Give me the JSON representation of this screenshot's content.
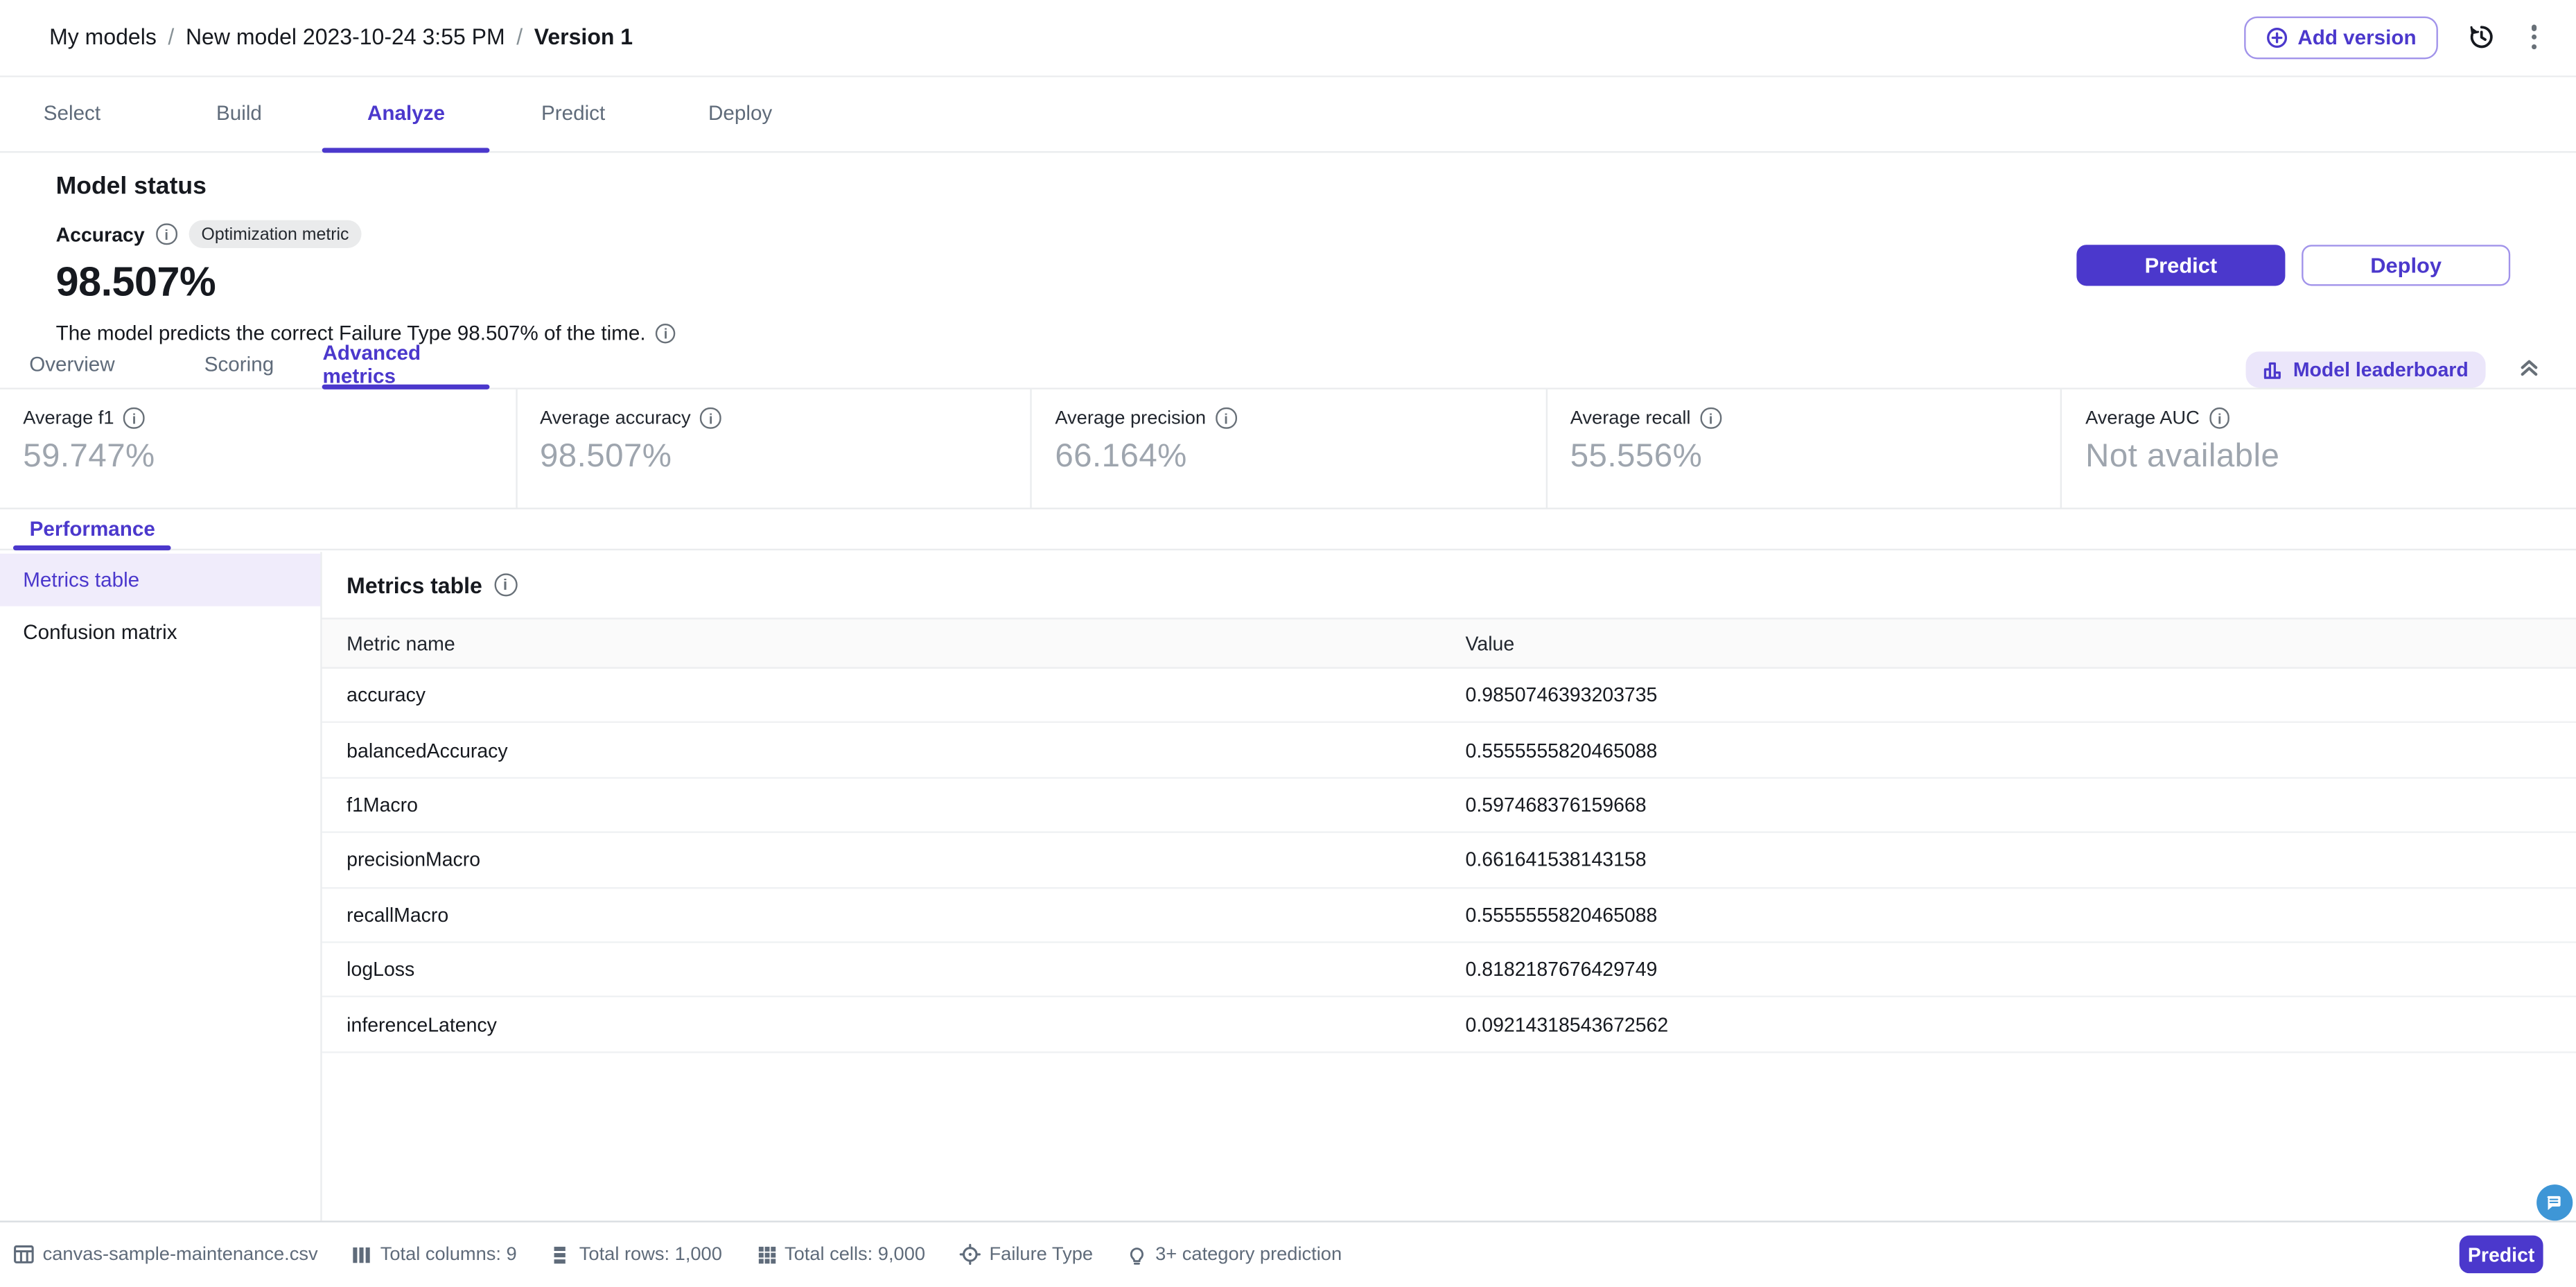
{
  "colors": {
    "accent": "#4B38CC",
    "accent_light_bg": "#F0ECFB",
    "leaderboard_bg": "#EBE6FA",
    "chat_fab": "#3E96D6"
  },
  "header": {
    "breadcrumb": [
      "My models",
      "New model 2023-10-24 3:55 PM",
      "Version 1"
    ],
    "breadcrumb_separator": "/",
    "add_version_label": "Add version",
    "icons": {
      "add_version": "plus-circle-icon",
      "history": "history-icon",
      "more": "kebab-menu-icon"
    }
  },
  "primary_tabs": {
    "items": [
      "Select",
      "Build",
      "Analyze",
      "Predict",
      "Deploy"
    ],
    "active": "Analyze"
  },
  "model_status": {
    "title": "Model status",
    "metric_label": "Accuracy",
    "optimization_badge": "Optimization metric",
    "value": "98.507%",
    "description": "The model predicts the correct Failure Type 98.507% of the time.",
    "predict_button": "Predict",
    "deploy_button": "Deploy"
  },
  "analysis_tabs": {
    "items": [
      "Overview",
      "Scoring",
      "Advanced metrics"
    ],
    "active": "Advanced metrics",
    "leaderboard_button": "Model leaderboard",
    "icons": {
      "leaderboard": "bar-chart-icon",
      "collapse": "double-chevron-up-icon"
    }
  },
  "metric_cards": [
    {
      "label": "Average f1",
      "value": "59.747%"
    },
    {
      "label": "Average accuracy",
      "value": "98.507%"
    },
    {
      "label": "Average precision",
      "value": "66.164%"
    },
    {
      "label": "Average recall",
      "value": "55.556%"
    },
    {
      "label": "Average AUC",
      "value": "Not available"
    }
  ],
  "performance_section": {
    "tab_label": "Performance",
    "sidebar_items": [
      "Metrics table",
      "Confusion matrix"
    ],
    "selected_sidebar_item": "Metrics table",
    "table": {
      "title": "Metrics table",
      "columns": [
        "Metric name",
        "Value"
      ],
      "rows": [
        {
          "name": "accuracy",
          "value": "0.9850746393203735"
        },
        {
          "name": "balancedAccuracy",
          "value": "0.5555555820465088"
        },
        {
          "name": "f1Macro",
          "value": "0.597468376159668"
        },
        {
          "name": "precisionMacro",
          "value": "0.661641538143158"
        },
        {
          "name": "recallMacro",
          "value": "0.5555555820465088"
        },
        {
          "name": "logLoss",
          "value": "0.8182187676429749"
        },
        {
          "name": "inferenceLatency",
          "value": "0.09214318543672562"
        }
      ]
    }
  },
  "status_bar": {
    "dataset_file": "canvas-sample-maintenance.csv",
    "total_columns": "Total columns: 9",
    "total_rows": "Total rows: 1,000",
    "total_cells": "Total cells: 9,000",
    "target_column": "Failure Type",
    "model_type": "3+ category prediction",
    "predict_button": "Predict",
    "icons": {
      "dataset": "table-icon",
      "columns": "columns-icon",
      "rows": "rows-icon",
      "cells": "cells-grid-icon",
      "target": "target-icon",
      "model_type": "lightbulb-icon",
      "chat": "chat-bubble-icon"
    }
  }
}
